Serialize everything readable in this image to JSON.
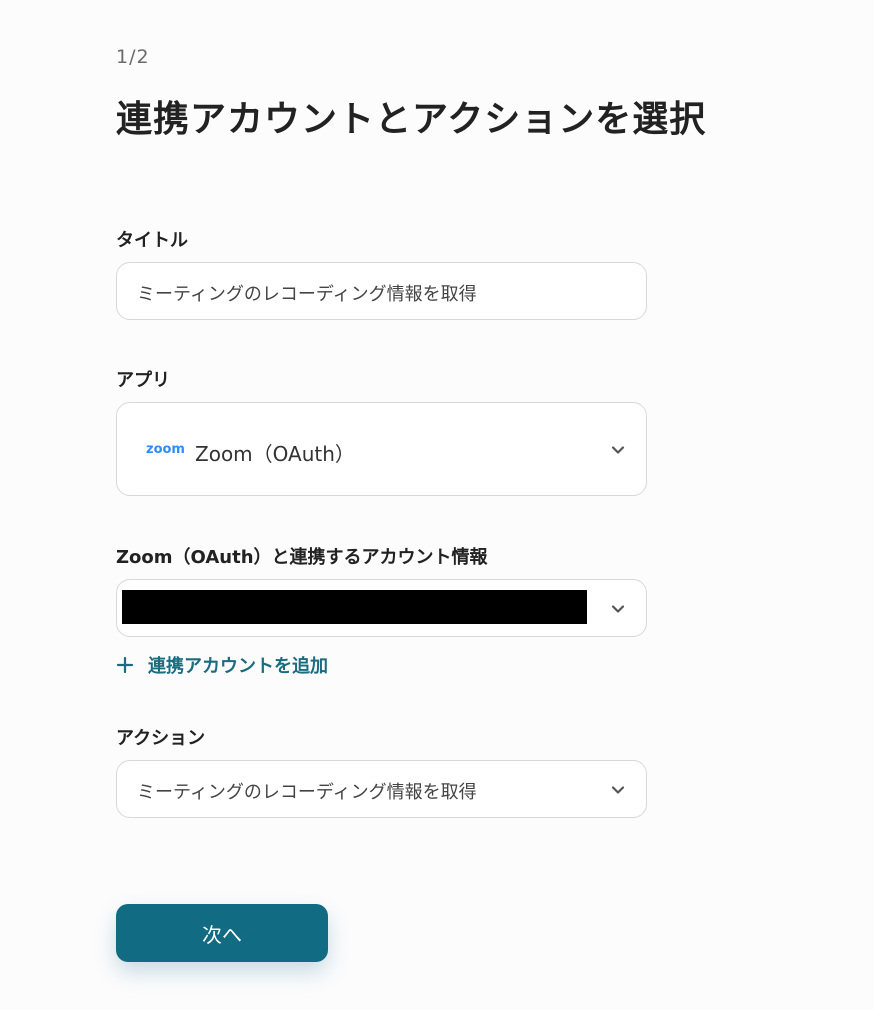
{
  "header": {
    "step": "1/2",
    "title": "連携アカウントとアクションを選択"
  },
  "title_field": {
    "label": "タイトル",
    "value": "ミーティングのレコーディング情報を取得"
  },
  "app_field": {
    "label": "アプリ",
    "logo_text": "zoom",
    "value": "Zoom（OAuth）",
    "icon": "chevron-down-icon"
  },
  "account_field": {
    "label": "Zoom（OAuth）と連携するアカウント情報",
    "icon": "chevron-down-icon"
  },
  "add_account": {
    "label": "連携アカウントを追加",
    "icon": "plus-icon"
  },
  "action_field": {
    "label": "アクション",
    "value": "ミーティングのレコーディング情報を取得",
    "icon": "chevron-down-icon"
  },
  "next_button": {
    "label": "次へ"
  },
  "colors": {
    "primary": "#116b82",
    "link": "#1a6c80",
    "zoom_blue": "#2d8cff"
  }
}
